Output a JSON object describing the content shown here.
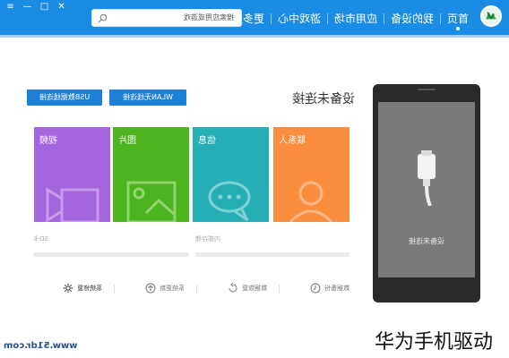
{
  "app": {
    "nav": [
      "首页",
      "我的设备",
      "应用市场",
      "游戏中心",
      "更多服务"
    ],
    "active_nav_index": 0,
    "search_placeholder": "搜索应用或游戏",
    "window_controls": [
      "✕",
      "□",
      "—",
      "≡"
    ],
    "accent_color": "#1b8ce3"
  },
  "device": {
    "title": "设备未连接",
    "wlan_button": "WLAN无线连接",
    "usb_button": "USB数据线连接"
  },
  "tiles": [
    {
      "label": "联系人",
      "color": "#fb8d3e",
      "icon": "contacts-icon"
    },
    {
      "label": "信息",
      "color": "#26aeb5",
      "icon": "message-icon"
    },
    {
      "label": "图片",
      "color": "#4cb41f",
      "icon": "picture-icon"
    },
    {
      "label": "视频",
      "color": "#a565dd",
      "icon": "video-icon"
    }
  ],
  "storage": {
    "internal_label": "内部存储",
    "sd_label": "SD卡"
  },
  "tools": [
    {
      "label": "数据备份",
      "icon": "backup-icon"
    },
    {
      "label": "数据恢复",
      "icon": "restore-icon"
    },
    {
      "label": "系统更新",
      "icon": "update-icon"
    },
    {
      "label": "系统修复",
      "icon": "repair-icon"
    }
  ],
  "phone": {
    "status_text": "设备未连接"
  },
  "watermarks": {
    "site": "www.51dr.com",
    "title": "华为手机驱动"
  }
}
